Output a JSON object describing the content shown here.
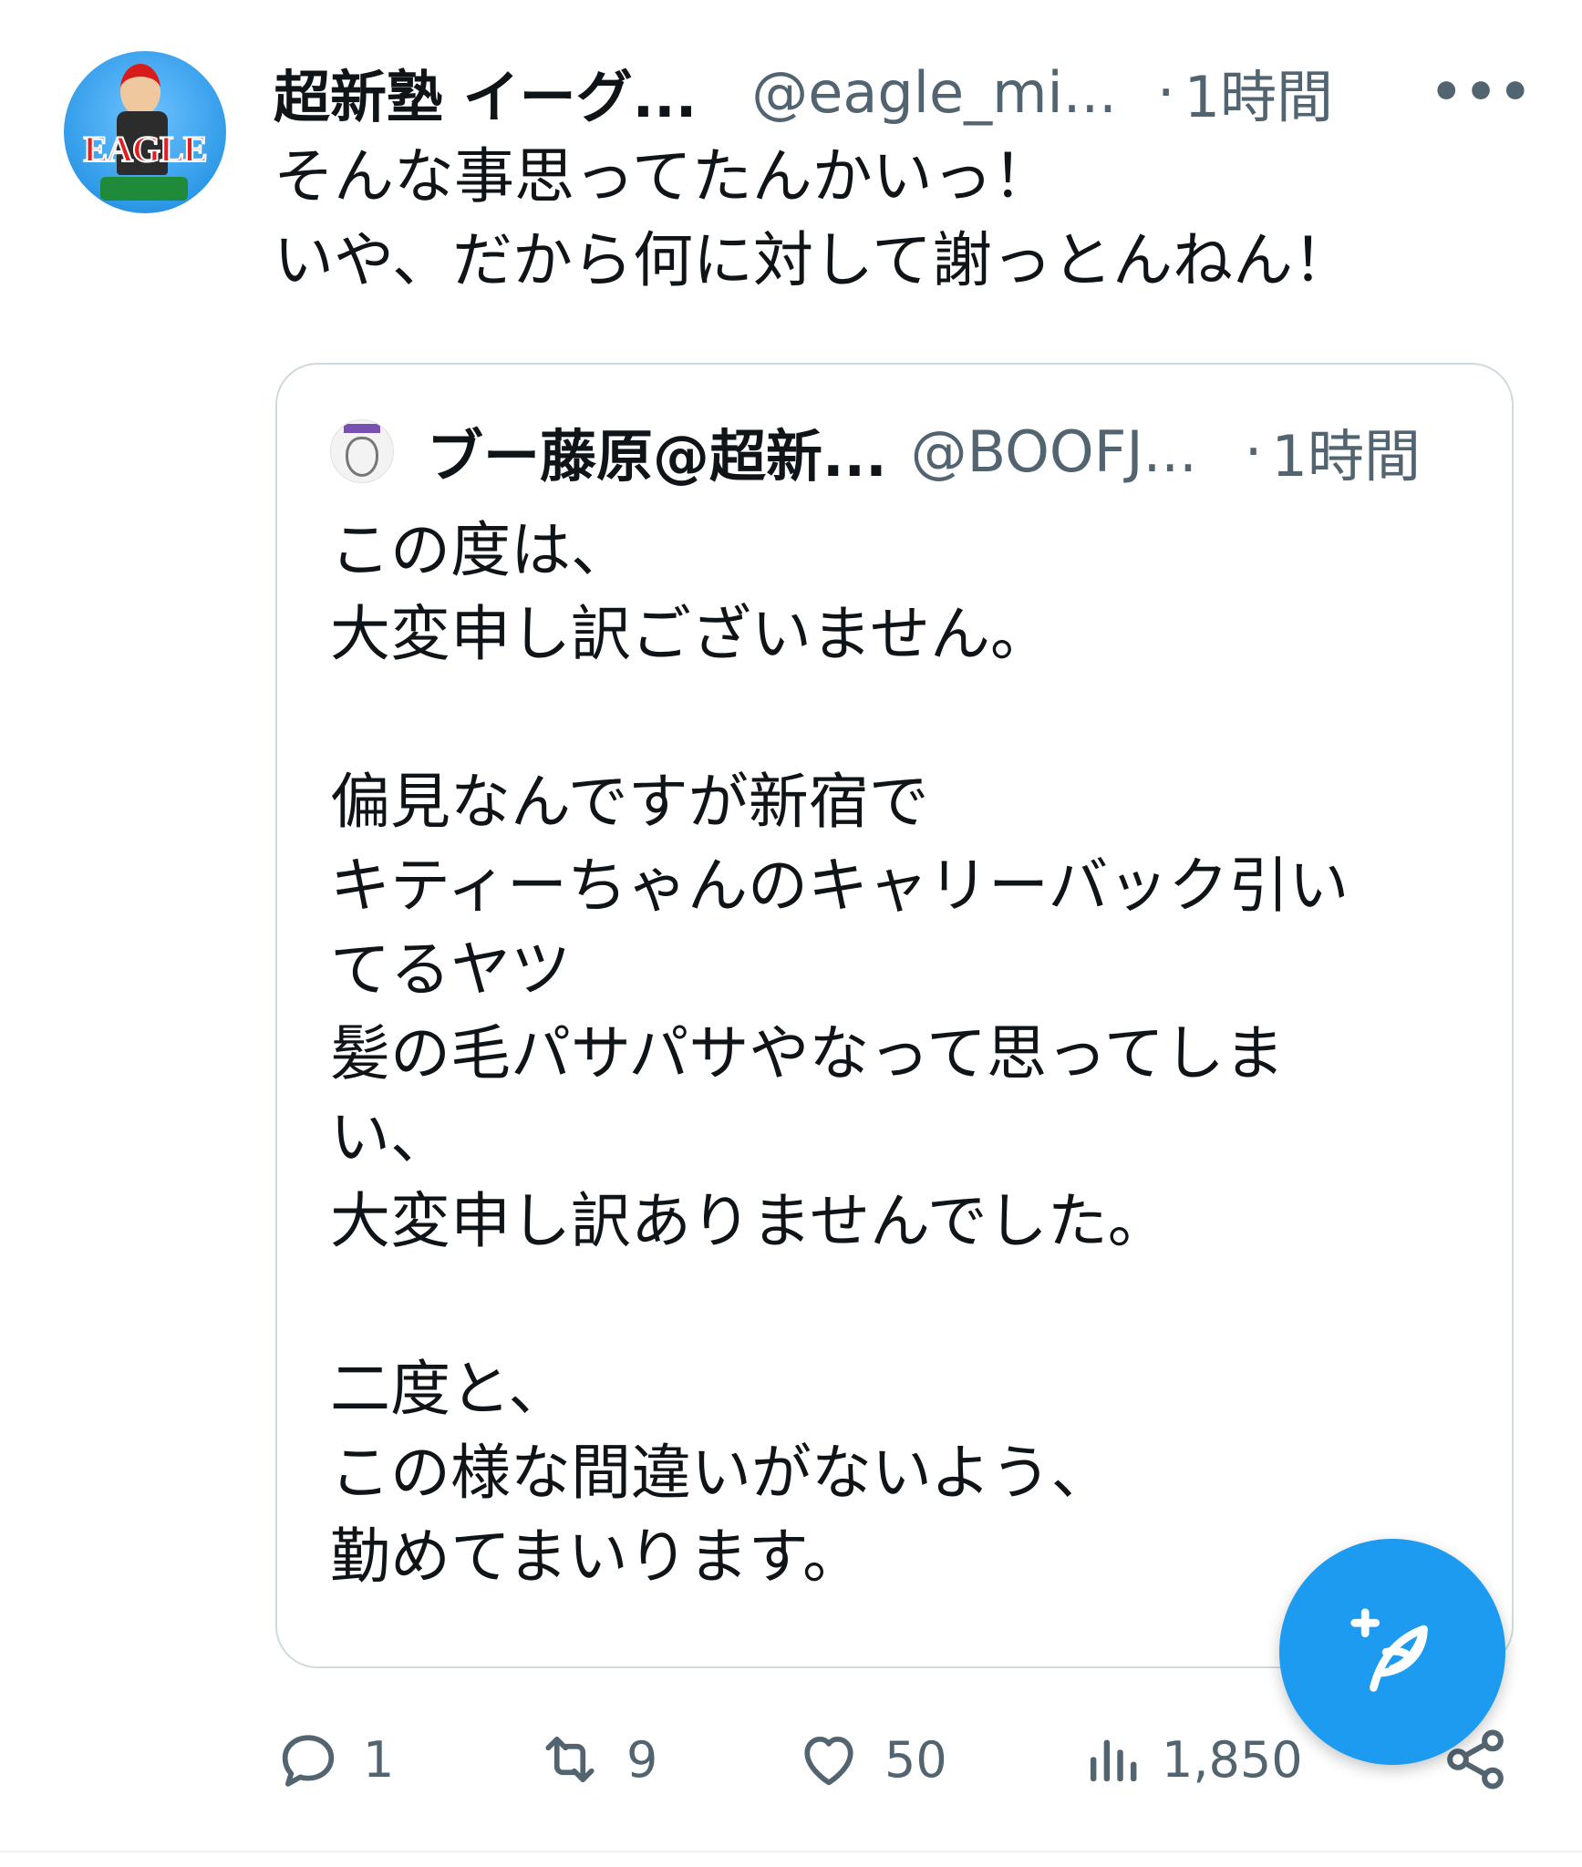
{
  "tweet": {
    "author_name": "超新塾 イーグ...",
    "handle": "@eagle_mi...",
    "separator": "·",
    "time": "1時間",
    "more_label": "•••",
    "avatar_logo_text": "EAGLE",
    "text": "そんな事思ってたんかいっ！\nいや、だから何に対して謝っとんねん！"
  },
  "quoted_tweet": {
    "author_name": "ブー藤原@超新...",
    "handle": "@BOOFJ...",
    "separator": "·",
    "time": "1時間",
    "text": "この度は、\n大変申し訳ございません。\n\n偏見なんですが新宿で\nキティーちゃんのキャリーバック引い\nてるヤツ\n髪の毛パサパサやなって思ってしま\nい、\n大変申し訳ありませんでした。\n\n二度と、\nこの様な間違いがないよう、\n勤めてまいります。"
  },
  "actions": {
    "reply": {
      "icon": "reply-icon",
      "count": "1"
    },
    "retweet": {
      "icon": "retweet-icon",
      "count": "9"
    },
    "like": {
      "icon": "heart-icon",
      "count": "50"
    },
    "views": {
      "icon": "views-icon",
      "count": "1,850"
    },
    "share": {
      "icon": "share-icon"
    }
  },
  "compose": {
    "icon": "compose-feather-icon"
  },
  "colors": {
    "accent": "#1d9bf0",
    "text_primary": "#0f1419",
    "text_secondary": "#536471",
    "border": "#cfd9de"
  }
}
